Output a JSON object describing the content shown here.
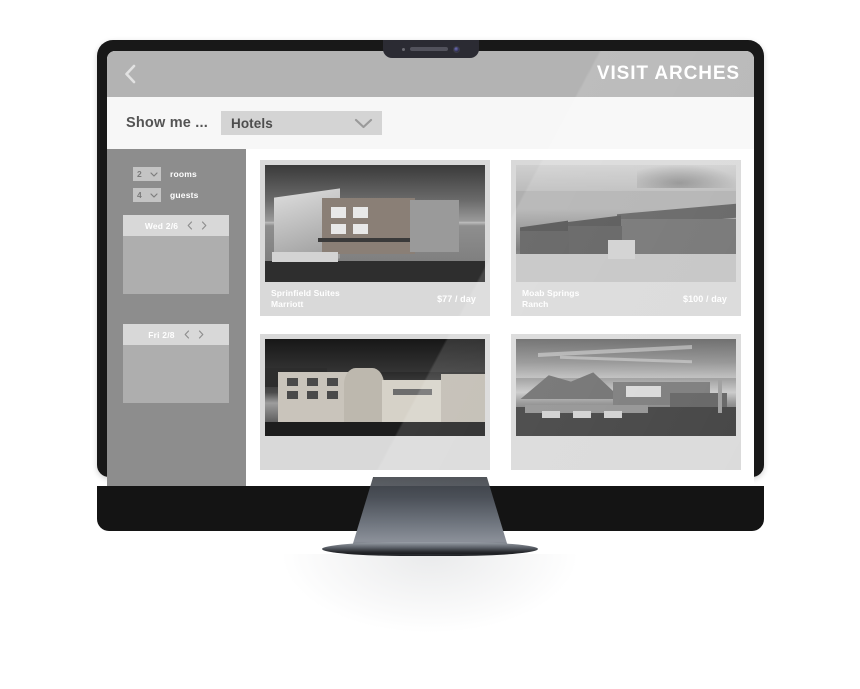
{
  "device": {
    "brand_icon": "apple-logo-icon",
    "camera_icon": "webcam-icon"
  },
  "app": {
    "title": "VISIT ARCHES",
    "back_icon": "chevron-left-icon"
  },
  "filter_bar": {
    "label": "Show me ...",
    "category_select": {
      "value": "Hotels",
      "icon": "chevron-down-icon"
    }
  },
  "sidebar": {
    "steppers": [
      {
        "value": "2",
        "label": "rooms",
        "icon": "chevron-down-icon"
      },
      {
        "value": "4",
        "label": "guests",
        "icon": "chevron-down-icon"
      }
    ],
    "datepickers": [
      {
        "date": "Wed 2/6",
        "prev_icon": "chevron-left-icon",
        "next_icon": "chevron-right-icon"
      },
      {
        "date": "Fri 2/8",
        "prev_icon": "chevron-left-icon",
        "next_icon": "chevron-right-icon"
      }
    ]
  },
  "results": {
    "cards": [
      {
        "name": "Sprinfield Suites\nMarriott",
        "name_line1": "Sprinfield Suites",
        "name_line2": "Marriott",
        "price": "$77 / day",
        "photo": "hotel-exterior-modern-lodge"
      },
      {
        "name": "Moab Springs Ranch",
        "name_line1": "Moab Springs",
        "name_line2": "Ranch",
        "price": "$100 / day",
        "photo": "hotel-exterior-cabins"
      },
      {
        "name_line1": "",
        "name_line2": "",
        "price": "",
        "photo": "hotel-exterior-holiday-inn-express"
      },
      {
        "name_line1": "",
        "name_line2": "",
        "price": "",
        "photo": "hotel-exterior-desert-dusk"
      }
    ]
  },
  "colors": {
    "header_bar": "#b3b3b3",
    "sidebar": "#8d8d8d",
    "card_bg": "#d9d9d9",
    "select_bg": "#d4d4d4",
    "page_bg": "#f7f7f7",
    "bezel": "#181818"
  }
}
